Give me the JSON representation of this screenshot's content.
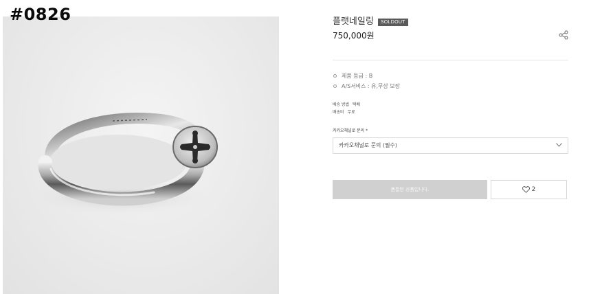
{
  "watermark": {
    "item_number": "#0826"
  },
  "product_image": {
    "subject": "silver ring with cross emblem"
  },
  "product": {
    "name": "플랫네일링",
    "badge": "SOLDOUT",
    "price": "750,000원"
  },
  "specs": [
    {
      "label": "제품 등급 : B"
    },
    {
      "label": "A/S서비스 : 유,무상 보장"
    }
  ],
  "shipping": {
    "method_label": "배송 방법",
    "method_value": "택배",
    "fee_label": "배송비",
    "fee_value": "무료"
  },
  "option": {
    "label": "카카오채널로 문의 *",
    "select_value": "카카오채널로 문의 (필수)"
  },
  "actions": {
    "soldout_label": "품절된 상품입니다.",
    "like_count": "2"
  },
  "icons": {
    "share": "share-icon",
    "chevron": "chevron-down-icon",
    "heart": "heart-icon"
  },
  "colors": {
    "badge_bg": "#5a5a5a",
    "soldout_button_bg": "#d0d0d0",
    "text_primary": "#333333"
  }
}
